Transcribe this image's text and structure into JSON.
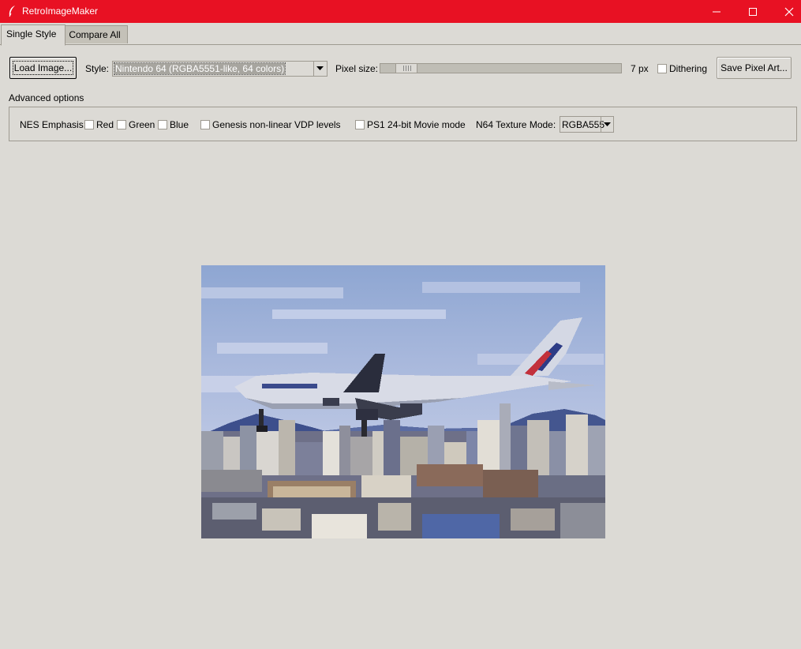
{
  "window": {
    "title": "RetroImageMaker",
    "bar_color": "#e81123"
  },
  "tabs": [
    {
      "label": "Single Style",
      "active": true
    },
    {
      "label": "Compare All",
      "active": false
    }
  ],
  "toolbar": {
    "load_label": "Load Image...",
    "style_label": "Style:",
    "style_value": "Nintendo 64 (RGBA5551-like, 64 colors)",
    "pixel_size_label": "Pixel size:",
    "pixel_size_value": "7 px",
    "dithering_label": "Dithering",
    "save_label": "Save Pixel Art..."
  },
  "advanced": {
    "label": "Advanced options",
    "nes_emphasis_label": "NES Emphasis:",
    "red_label": "Red",
    "green_label": "Green",
    "blue_label": "Blue",
    "genesis_label": "Genesis non-linear VDP levels",
    "ps1_label": "PS1 24-bit Movie mode",
    "n64_label": "N64 Texture Mode:",
    "n64_value": "RGBA555"
  },
  "icons": {
    "app": "feather-icon",
    "minimize": "minimize-icon",
    "maximize": "maximize-icon",
    "close": "close-icon",
    "dropdown": "chevron-down-icon",
    "preview": "pixelated-airplane-photo"
  }
}
